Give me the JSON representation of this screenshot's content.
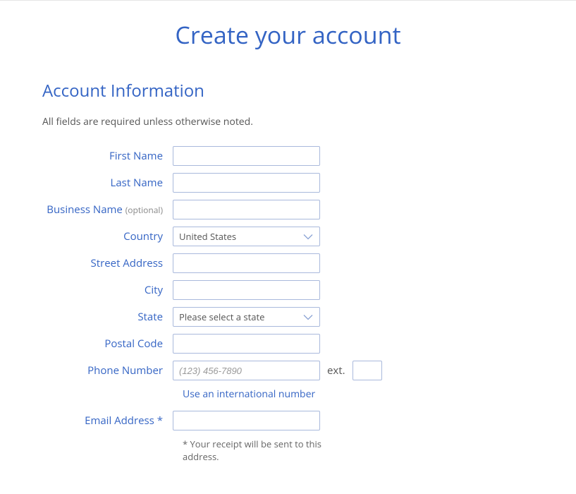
{
  "pageTitle": "Create your account",
  "sectionTitle": "Account Information",
  "helperText": "All fields are required unless otherwise noted.",
  "labels": {
    "firstName": "First Name",
    "lastName": "Last Name",
    "businessName": "Business Name",
    "businessOptional": "(optional)",
    "country": "Country",
    "streetAddress": "Street Address",
    "city": "City",
    "state": "State",
    "postalCode": "Postal Code",
    "phoneNumber": "Phone Number",
    "ext": "ext.",
    "emailAddress": "Email Address",
    "emailStar": "*"
  },
  "values": {
    "countrySelected": "United States",
    "stateSelected": "Please select a state"
  },
  "placeholders": {
    "phone": "(123) 456-7890"
  },
  "links": {
    "intlNumber": "Use an international number"
  },
  "notes": {
    "emailNote": "* Your receipt will be sent to this address."
  }
}
